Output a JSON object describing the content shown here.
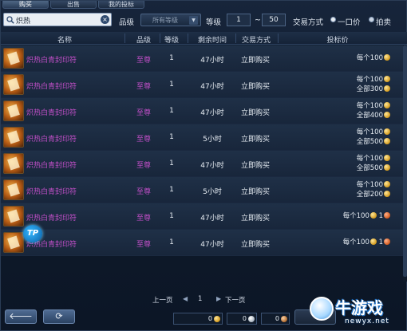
{
  "tabs": [
    {
      "label": "购买",
      "active": true
    },
    {
      "label": "出售",
      "active": false
    },
    {
      "label": "我的投标",
      "active": false
    }
  ],
  "filter": {
    "search_value": "炽热",
    "grade_label": "品级",
    "grade_value": "所有等级",
    "level_label": "等级",
    "level_min": "1",
    "level_sep": "~",
    "level_max": "50",
    "trade_label": "交易方式",
    "option_buyout": "一口价",
    "option_auction": "拍卖"
  },
  "columns": {
    "name": "名称",
    "grade": "品级",
    "level": "等级",
    "time": "剩余时间",
    "trade": "交易方式",
    "price": "投标价"
  },
  "rows": [
    {
      "name": "炽热白青封印符",
      "grade": "至尊",
      "level": "1",
      "time": "47小时",
      "trade": "立即购买",
      "price1": "每个100",
      "price2": ""
    },
    {
      "name": "炽热白青封印符",
      "grade": "至尊",
      "level": "1",
      "time": "47小时",
      "trade": "立即购买",
      "price1": "每个100",
      "price2": "全部300"
    },
    {
      "name": "炽热白青封印符",
      "grade": "至尊",
      "level": "1",
      "time": "47小时",
      "trade": "立即购买",
      "price1": "每个100",
      "price2": "全部400"
    },
    {
      "name": "炽热白青封印符",
      "grade": "至尊",
      "level": "1",
      "time": "5小时",
      "trade": "立即购买",
      "price1": "每个100",
      "price2": "全部500"
    },
    {
      "name": "炽热白青封印符",
      "grade": "至尊",
      "level": "1",
      "time": "47小时",
      "trade": "立即购买",
      "price1": "每个100",
      "price2": "全部500"
    },
    {
      "name": "炽热白青封印符",
      "grade": "至尊",
      "level": "1",
      "time": "5小时",
      "trade": "立即购买",
      "price1": "每个100",
      "price2": "全部200"
    },
    {
      "name": "炽热白青封印符",
      "grade": "至尊",
      "level": "1",
      "time": "47小时",
      "trade": "立即购买",
      "price1": "每个100",
      "price2": "",
      "extra": "1"
    },
    {
      "name": "炽热白青封印符",
      "grade": "至尊",
      "level": "1",
      "time": "47小时",
      "trade": "立即购买",
      "price1": "每个100",
      "price2": "",
      "extra": "1"
    }
  ],
  "pager": {
    "prev": "上一页",
    "page": "1",
    "next": "下一页"
  },
  "wallet": {
    "gold": "0",
    "silver": "0",
    "copper": "0"
  },
  "watermark": {
    "logo_text": "TP",
    "site_name": "牛游戏",
    "site_url": "newyx.net"
  },
  "icons": {
    "search": "search-icon",
    "clear": "close-icon",
    "back": "back-arrow-icon",
    "refresh": "refresh-icon"
  },
  "colors": {
    "item_name": "#c34fc9",
    "background": "#0f1b2c",
    "coin_gold": "#d39a1d"
  }
}
